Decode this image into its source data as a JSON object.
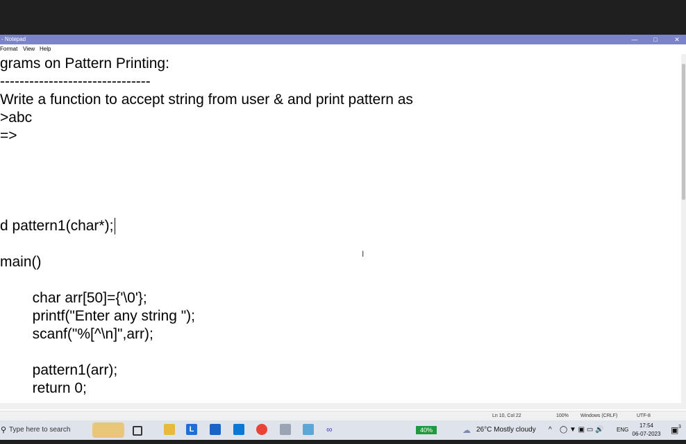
{
  "window": {
    "title": "- Notepad",
    "min": "—",
    "max": "□",
    "close": "✕"
  },
  "menu": {
    "items": [
      "Format",
      "View",
      "Help"
    ]
  },
  "editor": {
    "lines": [
      "grams on Pattern Printing:",
      "-------------------------------",
      "Write a function to accept string from user & and print pattern as",
      ">abc",
      "=>",
      "",
      "",
      "",
      "",
      "d pattern1(char*);",
      "",
      "main()",
      "",
      "        char arr[50]={'\\0'};",
      "        printf(\"Enter any string \");",
      "        scanf(\"%[^\\n]\",arr);",
      "",
      "        pattern1(arr);",
      "        return 0;"
    ],
    "ibeam": "I"
  },
  "status": {
    "position": "Ln 10, Col 22",
    "zoom": "100%",
    "eol": "Windows (CRLF)",
    "encoding": "UTF-8"
  },
  "taskbar": {
    "search_placeholder": "Type here to search",
    "battery": "40%",
    "weather": "26°C  Mostly cloudy",
    "lang": "ENG",
    "time": "17:54",
    "date": "06-07-2023",
    "notif_count": "3"
  }
}
